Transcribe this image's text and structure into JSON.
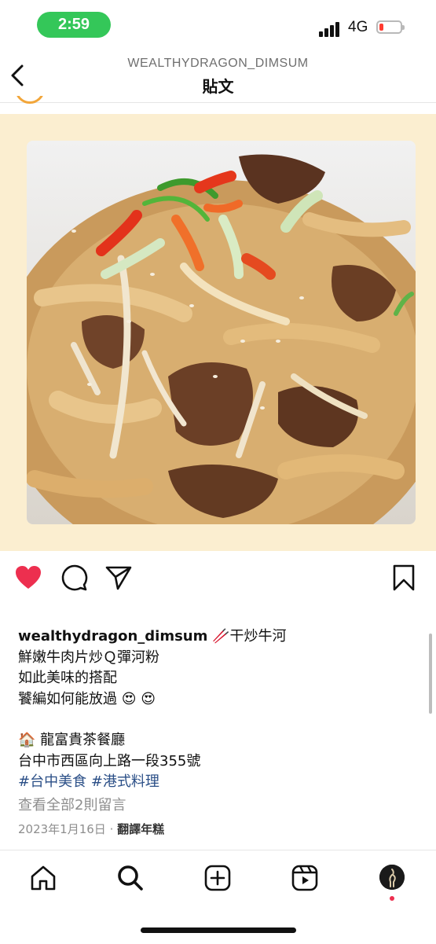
{
  "status_bar": {
    "time": "2:59",
    "network": "4G",
    "battery_color": "#ff3b30",
    "pill_color": "#34c759"
  },
  "header": {
    "account": "WEALTHYDRAGON_DIMSUM",
    "title": "貼文"
  },
  "post": {
    "media_background": "#fbeed0",
    "liked": true,
    "like_color": "#ed2f4f",
    "caption": {
      "username": "wealthydragon_dimsum",
      "title_emoji": "🥢",
      "title": "干炒牛河",
      "line1": "鮮嫩牛肉片炒Ｑ彈河粉",
      "line2": "如此美味的搭配",
      "line3": "饕編如何能放過",
      "line3_emoji": "😍 😍",
      "place_emoji": "🏠",
      "place": "龍富貴茶餐廳",
      "address": "台中市西區向上路一段355號",
      "hashtags": [
        "#台中美食",
        "#港式料理"
      ]
    },
    "view_comments": "查看全部2則留言",
    "date": "2023年1月16日",
    "separator": "·",
    "translate": "翻譯年糕"
  },
  "icons": {
    "back": "chevron-left-icon",
    "like": "heart-icon",
    "comment": "comment-icon",
    "share": "paper-plane-icon",
    "save": "bookmark-icon",
    "home": "home-icon",
    "search": "search-icon",
    "create": "plus-square-icon",
    "reels": "reels-icon",
    "profile": "avatar"
  }
}
